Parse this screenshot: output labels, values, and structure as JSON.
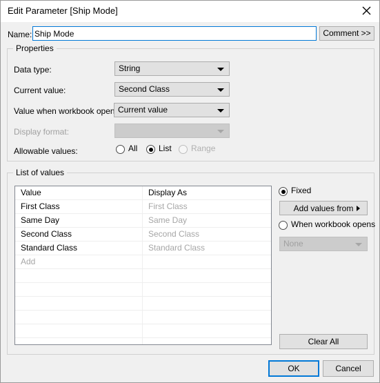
{
  "window": {
    "title": "Edit Parameter [Ship Mode]",
    "close_icon": "close-icon"
  },
  "name_row": {
    "label": "Name:",
    "value": "Ship Mode",
    "placeholder": "",
    "comment_button": "Comment >>"
  },
  "properties": {
    "legend": "Properties",
    "data_type": {
      "label": "Data type:",
      "value": "String"
    },
    "current_value": {
      "label": "Current value:",
      "value": "Second Class"
    },
    "value_when_opens": {
      "label": "Value when workbook opens:",
      "value": "Current value"
    },
    "display_format": {
      "label": "Display format:",
      "value": "",
      "disabled": true
    },
    "allowable_values": {
      "label": "Allowable values:",
      "options": [
        {
          "label": "All",
          "checked": false,
          "disabled": false
        },
        {
          "label": "List",
          "checked": true,
          "disabled": false
        },
        {
          "label": "Range",
          "checked": false,
          "disabled": true
        }
      ]
    }
  },
  "list_of_values": {
    "legend": "List of values",
    "columns": [
      "Value",
      "Display As"
    ],
    "rows": [
      {
        "value": "First Class",
        "display_as": "First Class"
      },
      {
        "value": "Same Day",
        "display_as": "Same Day"
      },
      {
        "value": "Second Class",
        "display_as": "Second Class"
      },
      {
        "value": "Standard Class",
        "display_as": "Standard Class"
      }
    ],
    "add_row_placeholder": "Add",
    "empty_rows": 6,
    "side_panel": {
      "fixed_radio": {
        "label": "Fixed",
        "checked": true
      },
      "add_values_from_button": "Add values from",
      "when_workbook_opens_radio": {
        "label": "When workbook opens",
        "checked": false
      },
      "none_combo": {
        "value": "None",
        "disabled": true
      },
      "clear_all_button": "Clear All"
    }
  },
  "footer": {
    "ok_button": "OK",
    "cancel_button": "Cancel"
  },
  "colors": {
    "accent": "#0078d7",
    "dialog_bg": "#f0f0f0",
    "titlebar_bg": "#ffffff",
    "control_bg": "#e1e1e1",
    "disabled_text": "#a0a0a0"
  }
}
